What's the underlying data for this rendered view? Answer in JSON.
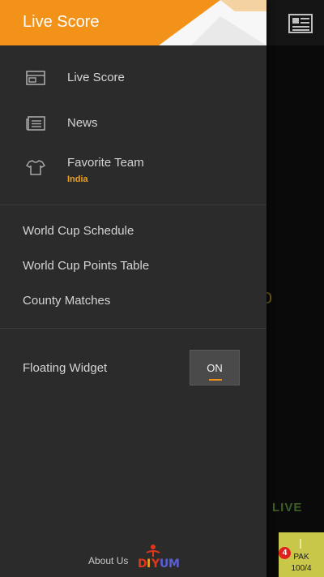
{
  "drawer": {
    "title": "Live Score",
    "primary_items": [
      {
        "label": "Live Score",
        "icon": "live-score-icon"
      },
      {
        "label": "News",
        "icon": "news-icon"
      },
      {
        "label": "Favorite Team",
        "subtitle": "India",
        "icon": "jersey-icon"
      }
    ],
    "secondary_items": [
      {
        "label": "World Cup Schedule"
      },
      {
        "label": "World Cup Points Table"
      },
      {
        "label": "County Matches"
      }
    ],
    "floating_widget": {
      "label": "Floating Widget",
      "state": "ON"
    },
    "about": {
      "label": "About Us",
      "logo_text": "DIYUM"
    }
  },
  "background": {
    "live_label": "LIVE",
    "score_card": {
      "badge": "4",
      "team": "PAK",
      "score": "100/4"
    }
  },
  "colors": {
    "accent": "#f39219",
    "drawer_bg": "#2b2b2b",
    "subtitle": "#f0a21c",
    "score_card": "#c9c74a"
  }
}
